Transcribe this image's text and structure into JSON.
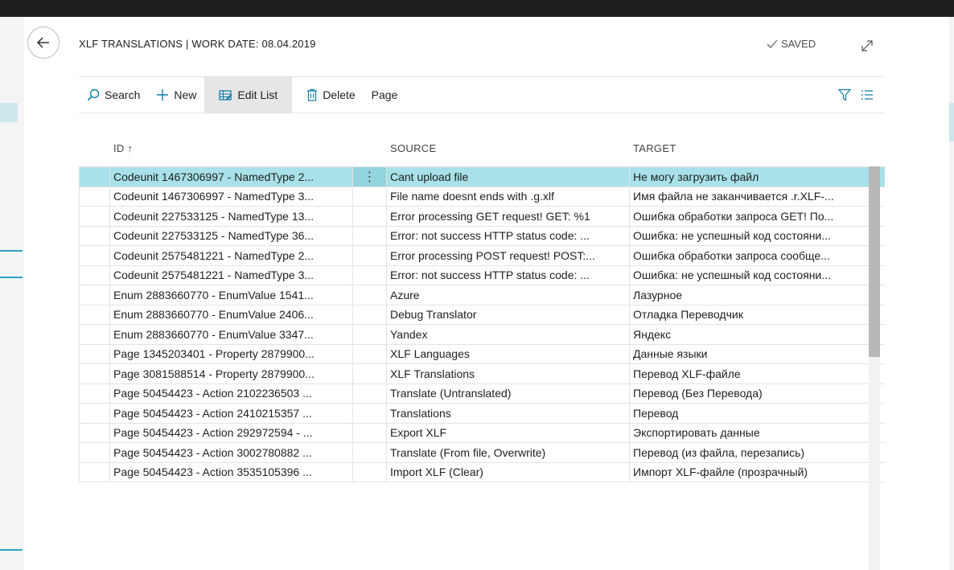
{
  "header": {
    "title": "XLF TRANSLATIONS | WORK DATE: 08.04.2019",
    "saved_label": "SAVED"
  },
  "toolbar": {
    "search_label": "Search",
    "new_label": "New",
    "edit_list_label": "Edit List",
    "delete_label": "Delete",
    "page_label": "Page"
  },
  "table": {
    "columns": {
      "id": "ID ↑",
      "source": "SOURCE",
      "target": "TARGET"
    },
    "rows": [
      {
        "id": "Codeunit 1467306997 - NamedType 2...",
        "source": "Cant upload file",
        "target": "Не могу загрузить файл"
      },
      {
        "id": "Codeunit 1467306997 - NamedType 3...",
        "source": "File name doesnt ends with .g.xlf",
        "target": "Имя файла не заканчивается .r.XLF-..."
      },
      {
        "id": "Codeunit 227533125 - NamedType 13...",
        "source": "Error processing GET request! GET: %1",
        "target": "Ошибка обработки запроса GET! По..."
      },
      {
        "id": "Codeunit 227533125 - NamedType 36...",
        "source": "Error: not success HTTP status code: ...",
        "target": "Ошибка: не успешный код состояни..."
      },
      {
        "id": "Codeunit 2575481221 - NamedType 2...",
        "source": "Error processing POST request! POST:...",
        "target": "Ошибка обработки запроса сообще..."
      },
      {
        "id": "Codeunit 2575481221 - NamedType 3...",
        "source": "Error: not success HTTP status code: ...",
        "target": "Ошибка: не успешный код состояни..."
      },
      {
        "id": "Enum 2883660770 - EnumValue 1541...",
        "source": "Azure",
        "target": "Лазурное"
      },
      {
        "id": "Enum 2883660770 - EnumValue 2406...",
        "source": "Debug Translator",
        "target": "Отладка Переводчик"
      },
      {
        "id": "Enum 2883660770 - EnumValue 3347...",
        "source": "Yandex",
        "target": "Яндекс"
      },
      {
        "id": "Page 1345203401 - Property 2879900...",
        "source": "XLF Languages",
        "target": "Данные языки"
      },
      {
        "id": "Page 3081588514 - Property 2879900...",
        "source": "XLF Translations",
        "target": "Перевод XLF-файле"
      },
      {
        "id": "Page 50454423 - Action 2102236503 ...",
        "source": "Translate (Untranslated)",
        "target": "Перевод (Без Перевода)"
      },
      {
        "id": "Page 50454423 - Action 2410215357 ...",
        "source": "Translations",
        "target": "Перевод"
      },
      {
        "id": "Page 50454423 - Action 292972594 - ...",
        "source": "Export XLF",
        "target": "Экспортировать данные"
      },
      {
        "id": "Page 50454423 - Action 3002780882 ...",
        "source": "Translate (From file, Overwrite)",
        "target": "Перевод (из файла, перезапись)"
      },
      {
        "id": "Page 50454423 - Action 3535105396 ...",
        "source": "Import XLF (Clear)",
        "target": "Импорт XLF-файле (прозрачный)"
      }
    ],
    "selected_row_index": 0
  },
  "icons": {
    "back": "back-arrow-icon",
    "saved": "checkmark-icon",
    "expand": "expand-icon",
    "search": "search-icon",
    "new": "plus-icon",
    "edit_list": "edit-list-icon",
    "delete": "trash-icon",
    "filter": "filter-icon",
    "list_view": "list-view-icon",
    "row_actions": "more-vertical-icon"
  },
  "colors": {
    "accent": "#0f7ea8",
    "selected_row": "#a8e1e9"
  }
}
